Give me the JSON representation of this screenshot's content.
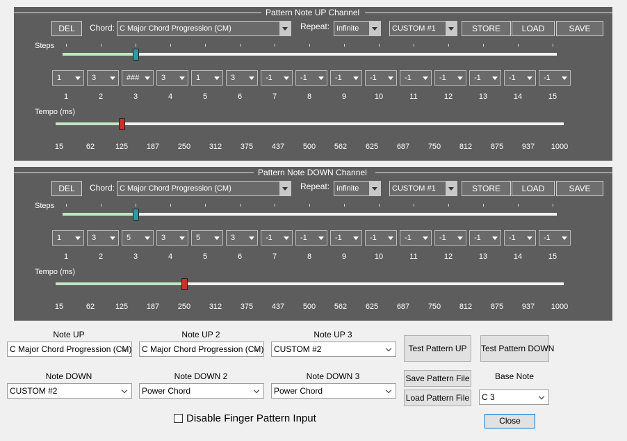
{
  "panels": [
    {
      "title": "Pattern Note UP Channel",
      "del_label": "DEL",
      "chord_label": "Chord:",
      "chord_value": "C Major Chord  Progression (CM)",
      "repeat_label": "Repeat:",
      "repeat_value": "Infinite",
      "custom_value": "CUSTOM #1",
      "store_label": "STORE",
      "load_label": "LOAD",
      "save_label": "SAVE",
      "steps_label": "Steps",
      "steps_slider_value": 3,
      "step_values": [
        "1",
        "3",
        "###",
        "3",
        "1",
        "3",
        "-1",
        "-1",
        "-1",
        "-1",
        "-1",
        "-1",
        "-1",
        "-1",
        "-1"
      ],
      "step_numbers": [
        "1",
        "2",
        "3",
        "4",
        "5",
        "6",
        "7",
        "8",
        "9",
        "10",
        "11",
        "12",
        "13",
        "14",
        "15"
      ],
      "tempo_label": "Tempo (ms)",
      "tempo_value": 125,
      "tempo_ticks": [
        "15",
        "62",
        "125",
        "187",
        "250",
        "312",
        "375",
        "437",
        "500",
        "562",
        "625",
        "687",
        "750",
        "812",
        "875",
        "937",
        "1000"
      ]
    },
    {
      "title": "Pattern Note DOWN Channel",
      "del_label": "DEL",
      "chord_label": "Chord:",
      "chord_value": "C Major Chord  Progression (CM)",
      "repeat_label": "Repeat:",
      "repeat_value": "Infinite",
      "custom_value": "CUSTOM #1",
      "store_label": "STORE",
      "load_label": "LOAD",
      "save_label": "SAVE",
      "steps_label": "Steps",
      "steps_slider_value": 3,
      "step_values": [
        "1",
        "3",
        "5",
        "3",
        "5",
        "3",
        "-1",
        "-1",
        "-1",
        "-1",
        "-1",
        "-1",
        "-1",
        "-1",
        "-1"
      ],
      "step_numbers": [
        "1",
        "2",
        "3",
        "4",
        "5",
        "6",
        "7",
        "8",
        "9",
        "10",
        "11",
        "12",
        "13",
        "14",
        "15"
      ],
      "tempo_label": "Tempo (ms)",
      "tempo_value": 250,
      "tempo_ticks": [
        "15",
        "62",
        "125",
        "187",
        "250",
        "312",
        "375",
        "437",
        "500",
        "562",
        "625",
        "687",
        "750",
        "812",
        "875",
        "937",
        "1000"
      ]
    }
  ],
  "bottom": {
    "note_up_label": "Note UP",
    "note_up_value": "C Major Chord  Progression (CM)",
    "note_up2_label": "Note UP 2",
    "note_up2_value": "C Major Chord  Progression (CM)",
    "note_up3_label": "Note UP 3",
    "note_up3_value": "CUSTOM #2",
    "note_down_label": "Note DOWN",
    "note_down_value": "CUSTOM #2",
    "note_down2_label": "Note DOWN 2",
    "note_down2_value": "Power Chord",
    "note_down3_label": "Note DOWN 3",
    "note_down3_value": "Power Chord",
    "test_up_label": "Test Pattern UP",
    "test_down_label": "Test Pattern DOWN",
    "save_file_label": "Save Pattern File",
    "load_file_label": "Load Pattern File",
    "base_note_label": "Base Note",
    "base_note_value": "C 3",
    "disable_label": "Disable Finger Pattern Input",
    "disable_checked": false,
    "close_label": "Close"
  }
}
